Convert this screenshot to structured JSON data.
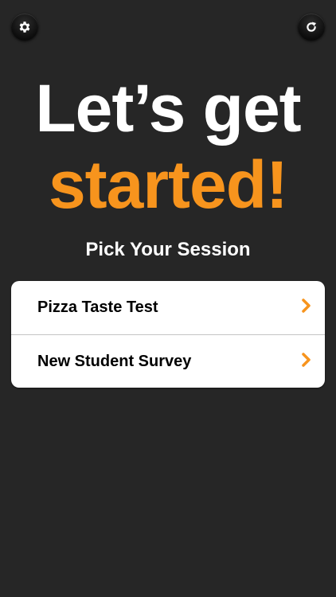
{
  "app": {
    "settings_icon": "gear-icon",
    "refresh_icon": "refresh-icon"
  },
  "headline": {
    "line1": "Let’s get",
    "line2": "started!"
  },
  "subtitle": "Pick Your Session",
  "sessions": [
    {
      "label": "Pizza Taste Test"
    },
    {
      "label": "New Student Survey"
    }
  ],
  "colors": {
    "accent": "#f7941d",
    "background": "#262626"
  }
}
